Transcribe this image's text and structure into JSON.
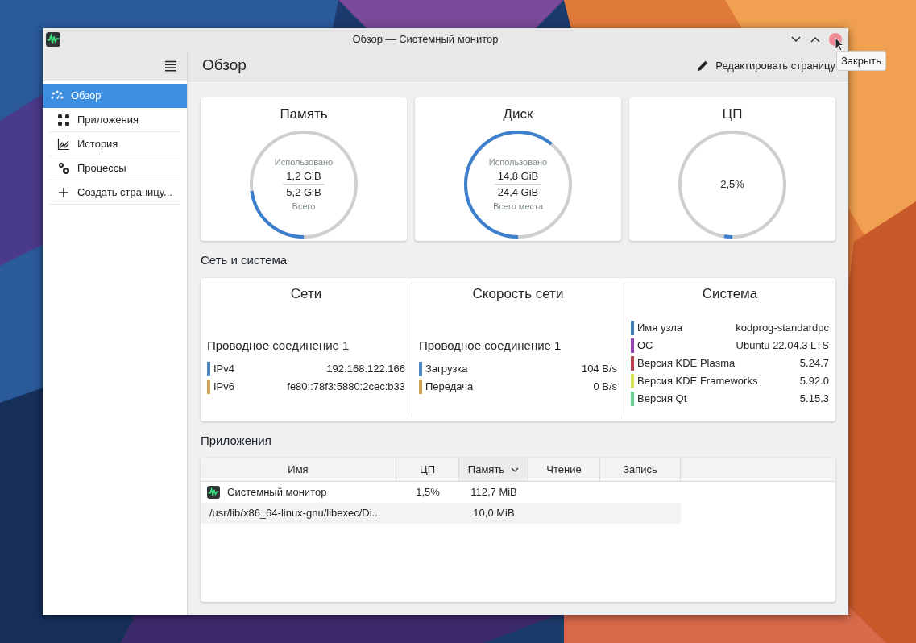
{
  "window": {
    "title": "Обзор — Системный монитор",
    "tooltip": "Закрыть"
  },
  "sidebar": {
    "items": [
      {
        "label": "Обзор",
        "kind": "overview",
        "selected": true
      },
      {
        "label": "Приложения",
        "kind": "apps",
        "selected": false
      },
      {
        "label": "История",
        "kind": "history",
        "selected": false
      },
      {
        "label": "Процессы",
        "kind": "processes",
        "selected": false
      },
      {
        "label": "Создать страницу...",
        "kind": "add",
        "selected": false
      }
    ]
  },
  "page": {
    "title": "Обзор",
    "edit_button": "Редактировать страницу"
  },
  "gauges": [
    {
      "kind": "usage",
      "title": "Память",
      "used_label": "Использовано",
      "used": "1,2 GiB",
      "total": "5,2 GiB",
      "total_label": "Всего",
      "level": 0.23
    },
    {
      "kind": "usage",
      "title": "Диск",
      "used_label": "Использовано",
      "used": "14,8 GiB",
      "total": "24,4 GiB",
      "total_label": "Всего места",
      "level": 0.61
    },
    {
      "kind": "percent",
      "title": "ЦП",
      "value": "2,5%",
      "level": 0.025
    }
  ],
  "network_system": {
    "heading": "Сеть и система",
    "columns": [
      {
        "title": "Сети",
        "connection": "Проводное соединение 1",
        "rows": [
          {
            "label": "IPv4",
            "value": "192.168.122.166",
            "color": "#4a86c0"
          },
          {
            "label": "IPv6",
            "value": "fe80::78f3:5880:2cec:b33",
            "color": "#d0a050"
          }
        ]
      },
      {
        "title": "Скорость сети",
        "connection": "Проводное соединение 1",
        "rows": [
          {
            "label": "Загрузка",
            "value": "104 B/s",
            "color": "#4a86c0"
          },
          {
            "label": "Передача",
            "value": "0 B/s",
            "color": "#d0a050"
          }
        ]
      },
      {
        "title": "Система",
        "rows": [
          {
            "label": "Имя узла",
            "value": "kodprog-standardpc",
            "color": "#3d7fc1"
          },
          {
            "label": "ОС",
            "value": "Ubuntu 22.04.3 LTS",
            "color": "#9b3dbf"
          },
          {
            "label": "Версия KDE Plasma",
            "value": "5.24.7",
            "color": "#b8414d"
          },
          {
            "label": "Версия KDE Frameworks",
            "value": "5.92.0",
            "color": "#d4e05a"
          },
          {
            "label": "Версия Qt",
            "value": "5.15.3",
            "color": "#5ed48c"
          }
        ]
      }
    ]
  },
  "applications": {
    "heading": "Приложения",
    "columns": [
      {
        "label": "Имя",
        "sorted": false
      },
      {
        "label": "ЦП",
        "sorted": false
      },
      {
        "label": "Память",
        "sorted": true
      },
      {
        "label": "Чтение",
        "sorted": false
      },
      {
        "label": "Запись",
        "sorted": false
      }
    ],
    "rows": [
      {
        "kind": "app",
        "name": "Системный монитор",
        "cpu": "1,5%",
        "memory": "112,7 MiB"
      },
      {
        "kind": "process",
        "name": "/usr/lib/x86_64-linux-gnu/libexec/Di...",
        "memory": "10,0 MiB"
      }
    ]
  }
}
